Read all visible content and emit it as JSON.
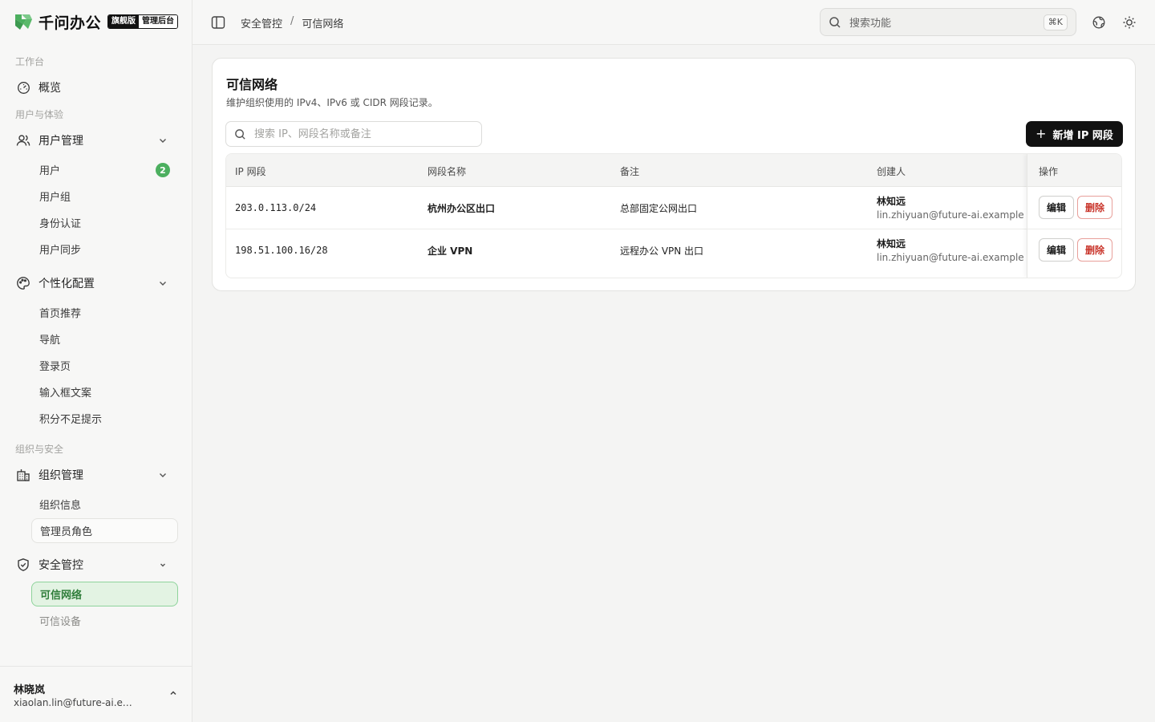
{
  "brand": {
    "name": "千问办公",
    "edition_badge": "旗舰版",
    "console_badge": "管理后台",
    "accent_color": "#4caf5f"
  },
  "sidebar": {
    "sections": {
      "workspace": "工作台",
      "user_experience": "用户与体验",
      "org_security": "组织与安全"
    },
    "overview": {
      "label": "概览",
      "icon": "dashboard-gauge-icon"
    },
    "user_mgmt": {
      "label": "用户管理",
      "icon": "users-icon",
      "items": [
        {
          "label": "用户",
          "badge": "2"
        },
        {
          "label": "用户组"
        },
        {
          "label": "身份认证"
        },
        {
          "label": "用户同步"
        }
      ]
    },
    "personalization": {
      "label": "个性化配置",
      "icon": "palette-icon",
      "items": [
        {
          "label": "首页推荐"
        },
        {
          "label": "导航"
        },
        {
          "label": "登录页"
        },
        {
          "label": "输入框文案"
        },
        {
          "label": "积分不足提示"
        }
      ]
    },
    "org_mgmt": {
      "label": "组织管理",
      "icon": "building-icon",
      "items": [
        {
          "label": "组织信息"
        },
        {
          "label": "管理员角色"
        }
      ]
    },
    "security": {
      "label": "安全管控",
      "icon": "shield-icon",
      "items": [
        {
          "label": "可信网络",
          "active": true
        },
        {
          "label": "可信设备"
        }
      ]
    },
    "footer": {
      "user_name": "林晓岚",
      "user_email": "xiaolan.lin@future-ai.example"
    }
  },
  "topbar": {
    "breadcrumb": [
      "安全管控",
      "可信网络"
    ],
    "search_placeholder": "搜索功能",
    "search_shortcut": "⌘K"
  },
  "page": {
    "title": "可信网络",
    "subtitle": "维护组织使用的 IPv4、IPv6 或 CIDR 网段记录。",
    "search_placeholder": "搜索 IP、网段名称或备注",
    "add_button": "新增 IP 网段",
    "columns": {
      "ip": "IP 网段",
      "name": "网段名称",
      "note": "备注",
      "creator": "创建人",
      "actions": "操作"
    },
    "rows": [
      {
        "ip": "203.0.113.0/24",
        "name": "杭州办公区出口",
        "note": "总部固定公网出口",
        "creator_name": "林知远",
        "creator_email": "lin.zhiyuan@future-ai.example",
        "edit": "编辑",
        "delete": "删除"
      },
      {
        "ip": "198.51.100.16/28",
        "name": "企业 VPN",
        "note": "远程办公 VPN 出口",
        "creator_name": "林知远",
        "creator_email": "lin.zhiyuan@future-ai.example",
        "edit": "编辑",
        "delete": "删除"
      }
    ]
  }
}
